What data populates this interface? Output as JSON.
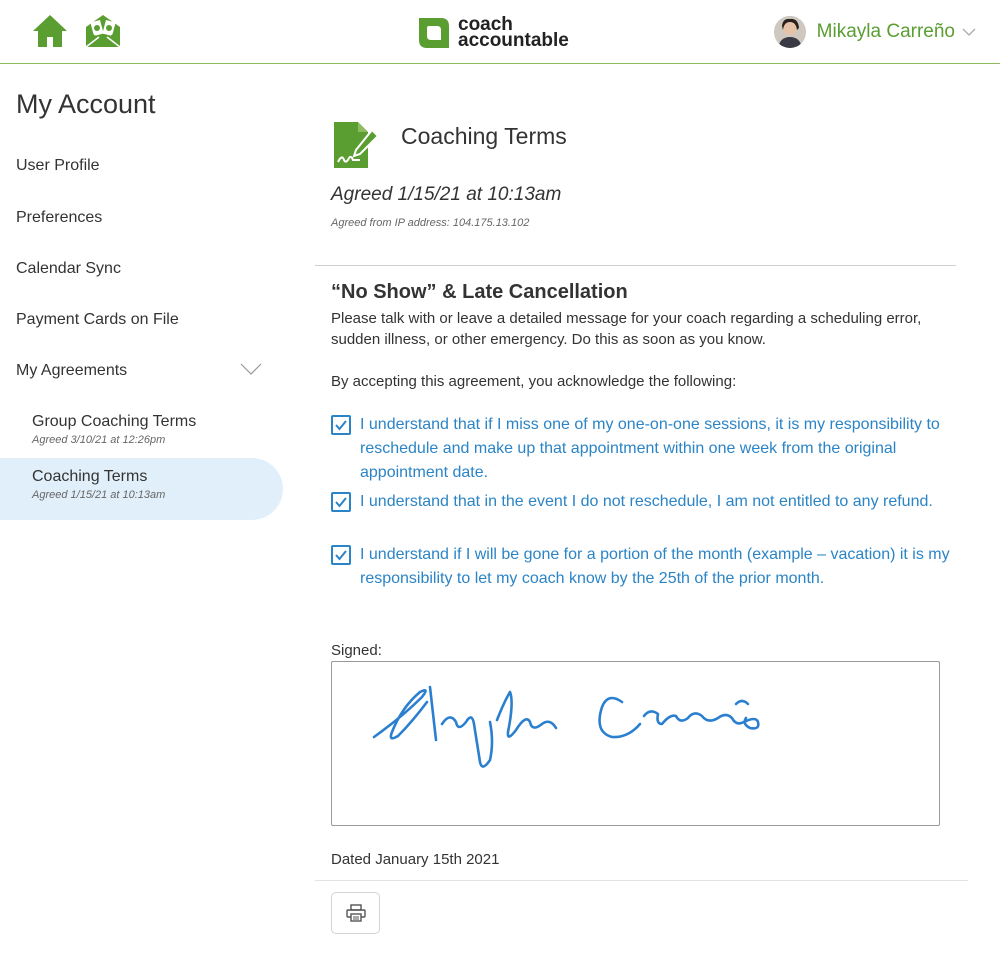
{
  "header": {
    "logo_line1": "coach",
    "logo_line2": "accountable",
    "user_name": "Mikayla Carreño",
    "brand_green": "#5a9e32",
    "icons": [
      "home-icon",
      "money-envelope-icon",
      "chevron-down-icon"
    ]
  },
  "sidebar": {
    "title": "My Account",
    "items": [
      {
        "label": "User Profile"
      },
      {
        "label": "Preferences"
      },
      {
        "label": "Calendar Sync"
      },
      {
        "label": "Payment Cards on File"
      },
      {
        "label": "My Agreements"
      }
    ],
    "agreements": [
      {
        "label": "Group Coaching Terms",
        "meta": "Agreed 3/10/21 at 12:26pm",
        "active": false
      },
      {
        "label": "Coaching Terms",
        "meta": "Agreed 1/15/21 at 10:13am",
        "active": true
      }
    ]
  },
  "main": {
    "title": "Coaching Terms",
    "agreed": "Agreed 1/15/21 at 10:13am",
    "ip": "Agreed from IP address: 104.175.13.102",
    "section_title": "“No Show” & Late Cancellation",
    "section_body": "Please talk with or leave a detailed message for your coach regarding a scheduling error, sudden illness, or other emergency.  Do this as soon as you know.",
    "accept_text": "By accepting this agreement, you acknowledge the following:",
    "checks": [
      {
        "label": "I understand that if I miss one of my one-on-one sessions, it is my responsibility to reschedule and make up that appointment within one week from the original appointment date.",
        "checked": true
      },
      {
        "label": "I understand that in the event I do not reschedule, I am not entitled to any refund.",
        "checked": true
      },
      {
        "label": "I understand if I will be gone for a portion of the month (example – vacation) it is my responsibility to let my coach know by the 25th of the prior month.",
        "checked": true
      }
    ],
    "signed_label": "Signed:",
    "dated": "Dated January 15th 2021",
    "accent_blue": "#2b84c6",
    "print_icon": "printer-icon"
  }
}
